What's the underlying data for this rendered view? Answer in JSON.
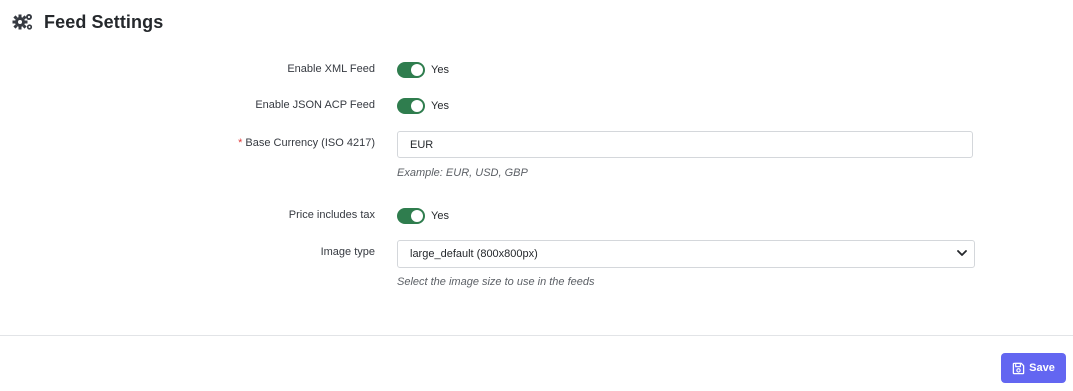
{
  "header": {
    "title": "Feed Settings",
    "icon": "gears-icon"
  },
  "fields": {
    "xml_feed": {
      "label": "Enable XML Feed",
      "enabled": true,
      "value_text": "Yes"
    },
    "json_feed": {
      "label": "Enable JSON ACP Feed",
      "enabled": true,
      "value_text": "Yes"
    },
    "currency": {
      "required_mark": "*",
      "label": "Base Currency (ISO 4217)",
      "value": "EUR",
      "help": "Example: EUR, USD, GBP"
    },
    "price_tax": {
      "label": "Price includes tax",
      "enabled": true,
      "value_text": "Yes"
    },
    "image_type": {
      "label": "Image type",
      "selected": "large_default (800x800px)",
      "help": "Select the image size to use in the feeds"
    }
  },
  "footer": {
    "save_label": "Save",
    "save_icon": "floppy-disk-icon"
  },
  "colors": {
    "toggle_on": "#2f7d4e",
    "save_button": "#6366f1",
    "required": "#e03a3a"
  }
}
